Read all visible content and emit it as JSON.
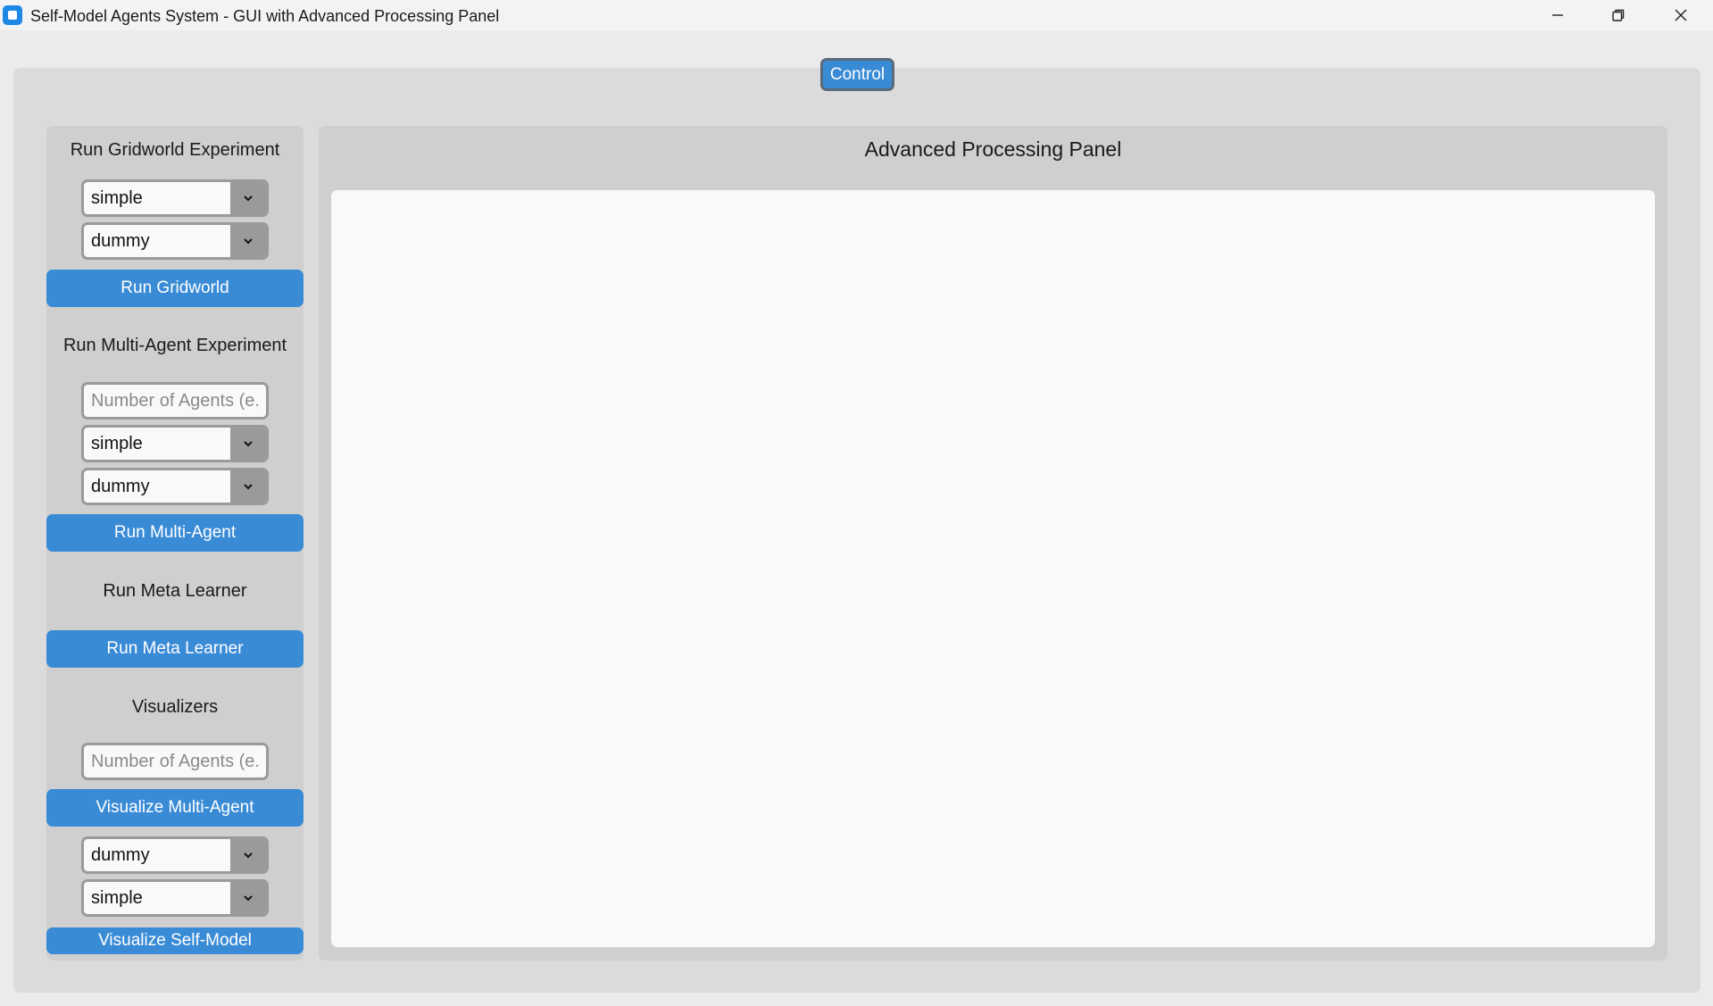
{
  "window": {
    "title": "Self-Model Agents System - GUI with Advanced Processing Panel",
    "icons": {
      "minimize": "minimize-icon",
      "maximize": "restore-icon",
      "close": "close-icon"
    }
  },
  "tabs": {
    "control_label": "Control"
  },
  "colors": {
    "accent": "#3a8bd6",
    "panel": "#cfcfcf",
    "frame": "#dbdbdb"
  },
  "gridworld": {
    "heading": "Run Gridworld Experiment",
    "env_value": "simple",
    "agent_value": "dummy",
    "run_label": "Run Gridworld"
  },
  "multi_agent": {
    "heading": "Run Multi-Agent Experiment",
    "agents_placeholder": "Number of Agents (e.",
    "env_value": "simple",
    "agent_value": "dummy",
    "run_label": "Run Multi-Agent"
  },
  "meta_learner": {
    "heading": "Run Meta Learner",
    "run_label": "Run Meta Learner"
  },
  "visualizers": {
    "heading": "Visualizers",
    "agents_placeholder": "Number of Agents (e.",
    "visualize_multi_label": "Visualize Multi-Agent",
    "agent_value": "dummy",
    "env_value": "simple",
    "visualize_self_label": "Visualize Self-Model"
  },
  "processing_panel": {
    "title": "Advanced Processing Panel"
  }
}
